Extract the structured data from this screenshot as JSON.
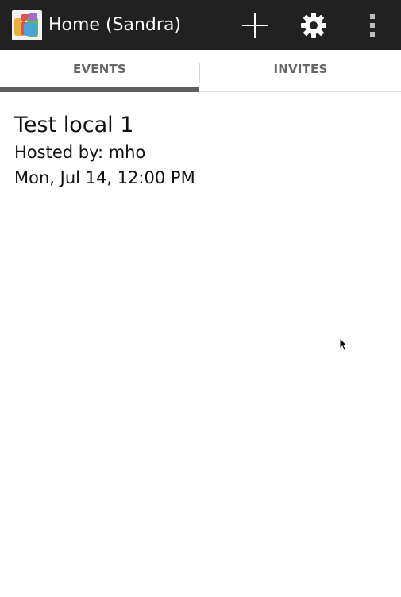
{
  "action_bar": {
    "title": "Home (Sandra)",
    "background_color": "#212121",
    "icons": {
      "app": "app-launcher-icon",
      "add": "plus-icon",
      "settings": "gear-icon",
      "overflow": "overflow-menu-icon"
    }
  },
  "tabs": [
    {
      "label": "EVENTS",
      "selected": true
    },
    {
      "label": "INVITES",
      "selected": false
    }
  ],
  "events": [
    {
      "title": "Test local 1",
      "host": "Hosted by: mho",
      "date": "Mon, Jul 14, 12:00 PM"
    }
  ],
  "colors": {
    "tab_indicator": "#5e5e5e",
    "tab_text": "#666666",
    "text": "#111111"
  }
}
